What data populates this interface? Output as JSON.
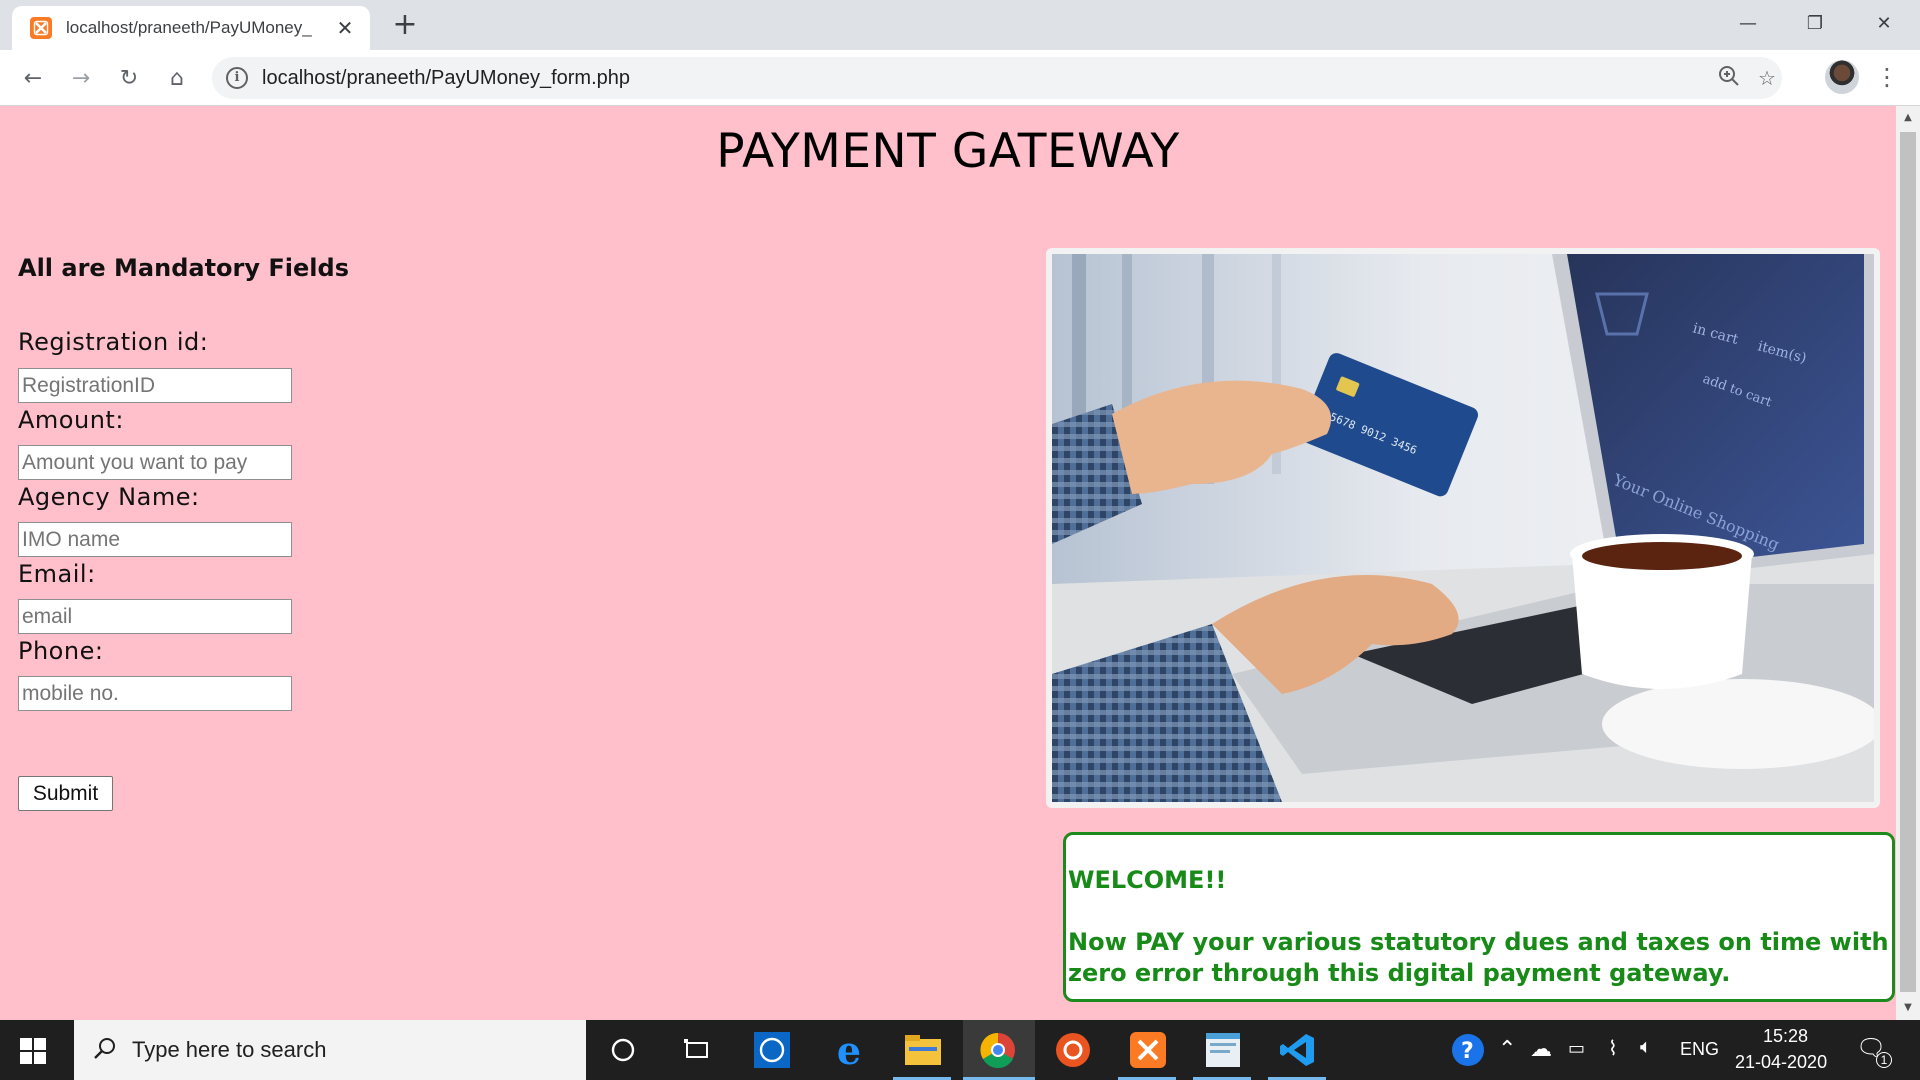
{
  "browser": {
    "tab_title": "localhost/praneeth/PayUMoney_",
    "tab_close": "✕",
    "new_tab": "+",
    "url": "localhost/praneeth/PayUMoney_form.php",
    "window_controls": {
      "minimize": "—",
      "maximize": "❐",
      "close": "✕"
    },
    "nav": {
      "back": "←",
      "forward": "→",
      "reload": "↻",
      "home": "⌂"
    },
    "icons": [
      "info-icon",
      "zoom-icon",
      "star-icon",
      "profile-avatar",
      "menu-icon"
    ]
  },
  "page": {
    "title": "PAYMENT GATEWAY",
    "mandatory_note": "All are Mandatory Fields",
    "fields": [
      {
        "label": "Registration id:",
        "placeholder": "RegistrationID"
      },
      {
        "label": "Amount:",
        "placeholder": "Amount you want to pay"
      },
      {
        "label": "Agency Name:",
        "placeholder": "IMO name"
      },
      {
        "label": "Email:",
        "placeholder": "email"
      },
      {
        "label": "Phone:",
        "placeholder": "mobile no."
      }
    ],
    "submit_label": "Submit",
    "hero_image": {
      "laptop_labels": [
        "in cart",
        "item(s)",
        "add to cart",
        "Your Online Shopping"
      ],
      "card_number": "5678 9012 3456"
    },
    "welcome": {
      "title": "WELCOME!!",
      "message": "Now PAY your various statutory dues and taxes on time with zero error through this digital payment gateway."
    },
    "colors": {
      "background": "#ffc0cb",
      "welcome_text": "#178a17",
      "welcome_border": "#1c8a1c"
    }
  },
  "taskbar": {
    "search_placeholder": "Type here to search",
    "apps": [
      "cortana-icon",
      "task-view-icon",
      "whatsapp-icon",
      "edge-icon",
      "file-explorer-icon",
      "chrome-icon",
      "ubuntu-icon",
      "xampp-icon",
      "notepad-icon",
      "vscode-icon"
    ],
    "language": "ENG",
    "time": "15:28",
    "date": "21-04-2020",
    "notification_count": "1"
  }
}
